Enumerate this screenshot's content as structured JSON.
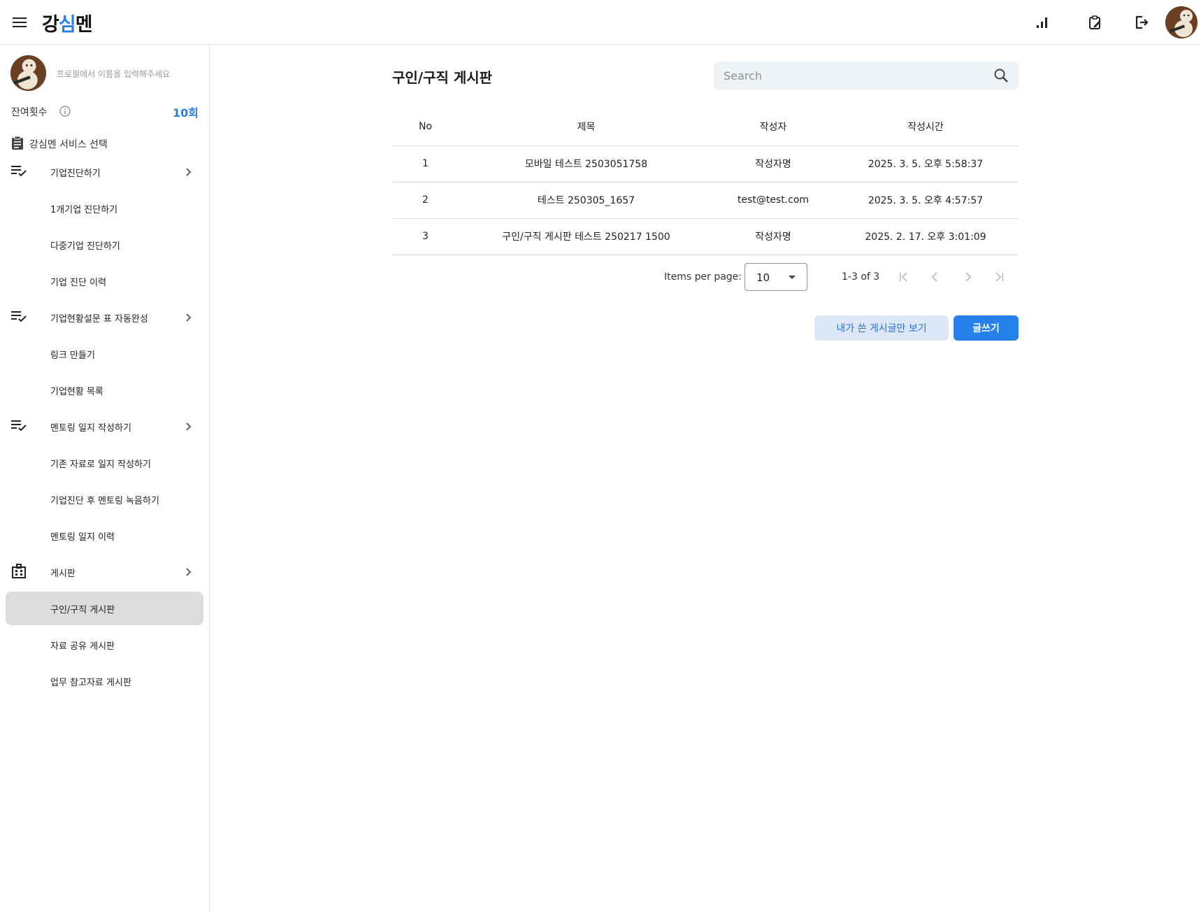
{
  "header": {
    "logo_parts": [
      "강",
      "심",
      "멘"
    ],
    "icons": [
      "menu-icon",
      "chart-bar-icon",
      "clipboard-edit-icon",
      "logout-icon"
    ]
  },
  "sidebar": {
    "profile_placeholder": "프로필에서 이름을 입력해주세요",
    "credits_label": "잔여횟수",
    "credits_value": "10회",
    "service_header": "강심멘 서비스 선택",
    "items": [
      {
        "label": "기업진단하기",
        "group": true,
        "icon": "checklist-icon"
      },
      {
        "label": "1개기업 진단하기",
        "group": false
      },
      {
        "label": "다중기업 진단하기",
        "group": false
      },
      {
        "label": "기업 진단 이력",
        "group": false
      },
      {
        "label": "기업현황설문 표 자동완성",
        "group": true,
        "icon": "checklist-icon"
      },
      {
        "label": "링크 만들기",
        "group": false
      },
      {
        "label": "기업현황 목록",
        "group": false
      },
      {
        "label": "멘토링 일지 작성하기",
        "group": true,
        "icon": "checklist-icon"
      },
      {
        "label": "기존 자료로 일지 작성하기",
        "group": false
      },
      {
        "label": "기업진단 후 멘토링 녹음하기",
        "group": false
      },
      {
        "label": "멘토링 일지 이력",
        "group": false
      },
      {
        "label": "게시판",
        "group": true,
        "icon": "building-icon"
      },
      {
        "label": "구인/구직 게시판",
        "group": false,
        "active": true
      },
      {
        "label": "자료 공유 게시판",
        "group": false
      },
      {
        "label": "업무 참고자료 게시판",
        "group": false
      }
    ]
  },
  "main": {
    "title": "구인/구직 게시판",
    "search_placeholder": "Search",
    "columns": [
      "No",
      "제목",
      "작성자",
      "작성시간"
    ],
    "rows": [
      [
        "1",
        "모바일 테스트 2503051758",
        "작성자명",
        "2025. 3. 5. 오후 5:58:37"
      ],
      [
        "2",
        "테스트 250305_1657",
        "test@test.com",
        "2025. 3. 5. 오후 4:57:57"
      ],
      [
        "3",
        "구인/구직 게시판 테스트 250217 1500",
        "작성자명",
        "2025. 2. 17. 오후 3:01:09"
      ]
    ],
    "pager": {
      "items_per_page_label": "Items per page:",
      "items_per_page_value": "10",
      "range": "1-3 of 3"
    },
    "buttons": {
      "mine": "내가 쓴 게시글만 보기",
      "write": "글쓰기"
    }
  },
  "colors": {
    "accent": "#2680eb",
    "active_nav_bg": "#dcdcdc",
    "secondary_button_bg": "#dce8f8"
  }
}
